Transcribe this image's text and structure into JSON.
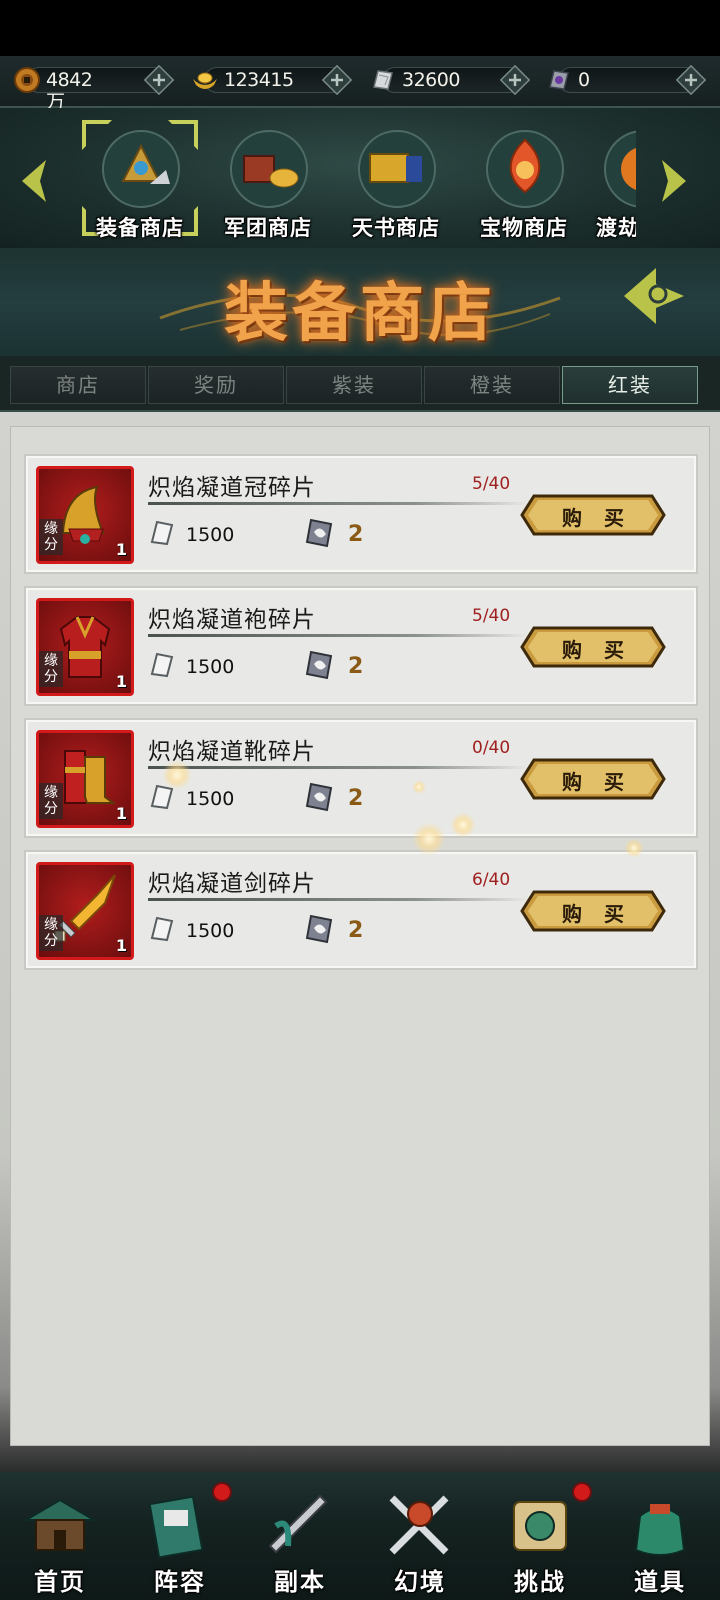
{
  "currencies": [
    {
      "icon": "copper-coin-icon",
      "value": "4842万"
    },
    {
      "icon": "gold-ingot-icon",
      "value": "123415"
    },
    {
      "icon": "silver-shard-icon",
      "value": "32600"
    },
    {
      "icon": "token-icon",
      "value": "0"
    }
  ],
  "shops": [
    {
      "label": "装备商店",
      "icon": "equipment-shop-icon",
      "selected": true
    },
    {
      "label": "军团商店",
      "icon": "legion-shop-icon"
    },
    {
      "label": "天书商店",
      "icon": "heavenly-book-shop-icon"
    },
    {
      "label": "宝物商店",
      "icon": "treasure-shop-icon"
    },
    {
      "label": "渡劫",
      "icon": "tribulation-shop-icon"
    }
  ],
  "banner": {
    "title": "装备商店"
  },
  "tabs": [
    {
      "label": "商店"
    },
    {
      "label": "奖励"
    },
    {
      "label": "紫装"
    },
    {
      "label": "橙装"
    },
    {
      "label": "红装",
      "active": true
    }
  ],
  "items": [
    {
      "name": "炽焰凝道冠碎片",
      "stock": "5/40",
      "price": "1500",
      "need": "2",
      "badge": "缘分",
      "count": "1",
      "icon": "helmet-icon",
      "buy": "购买"
    },
    {
      "name": "炽焰凝道袍碎片",
      "stock": "5/40",
      "price": "1500",
      "need": "2",
      "badge": "缘分",
      "count": "1",
      "icon": "robe-icon",
      "buy": "购买"
    },
    {
      "name": "炽焰凝道靴碎片",
      "stock": "0/40",
      "price": "1500",
      "need": "2",
      "badge": "缘分",
      "count": "1",
      "icon": "boots-icon",
      "buy": "购买"
    },
    {
      "name": "炽焰凝道剑碎片",
      "stock": "6/40",
      "price": "1500",
      "need": "2",
      "badge": "缘分",
      "count": "1",
      "icon": "sword-icon",
      "buy": "购买"
    }
  ],
  "nav": [
    {
      "label": "首页",
      "icon": "home-palace-icon"
    },
    {
      "label": "阵容",
      "icon": "lineup-icon",
      "badge": true
    },
    {
      "label": "副本",
      "icon": "dungeon-icon"
    },
    {
      "label": "幻境",
      "icon": "illusion-icon"
    },
    {
      "label": "挑战",
      "icon": "challenge-icon",
      "badge": true
    },
    {
      "label": "道具",
      "icon": "items-bag-icon"
    }
  ],
  "colors": {
    "accent": "#f0a34a",
    "stock": "#a02020",
    "frame": "#d21a1a"
  }
}
